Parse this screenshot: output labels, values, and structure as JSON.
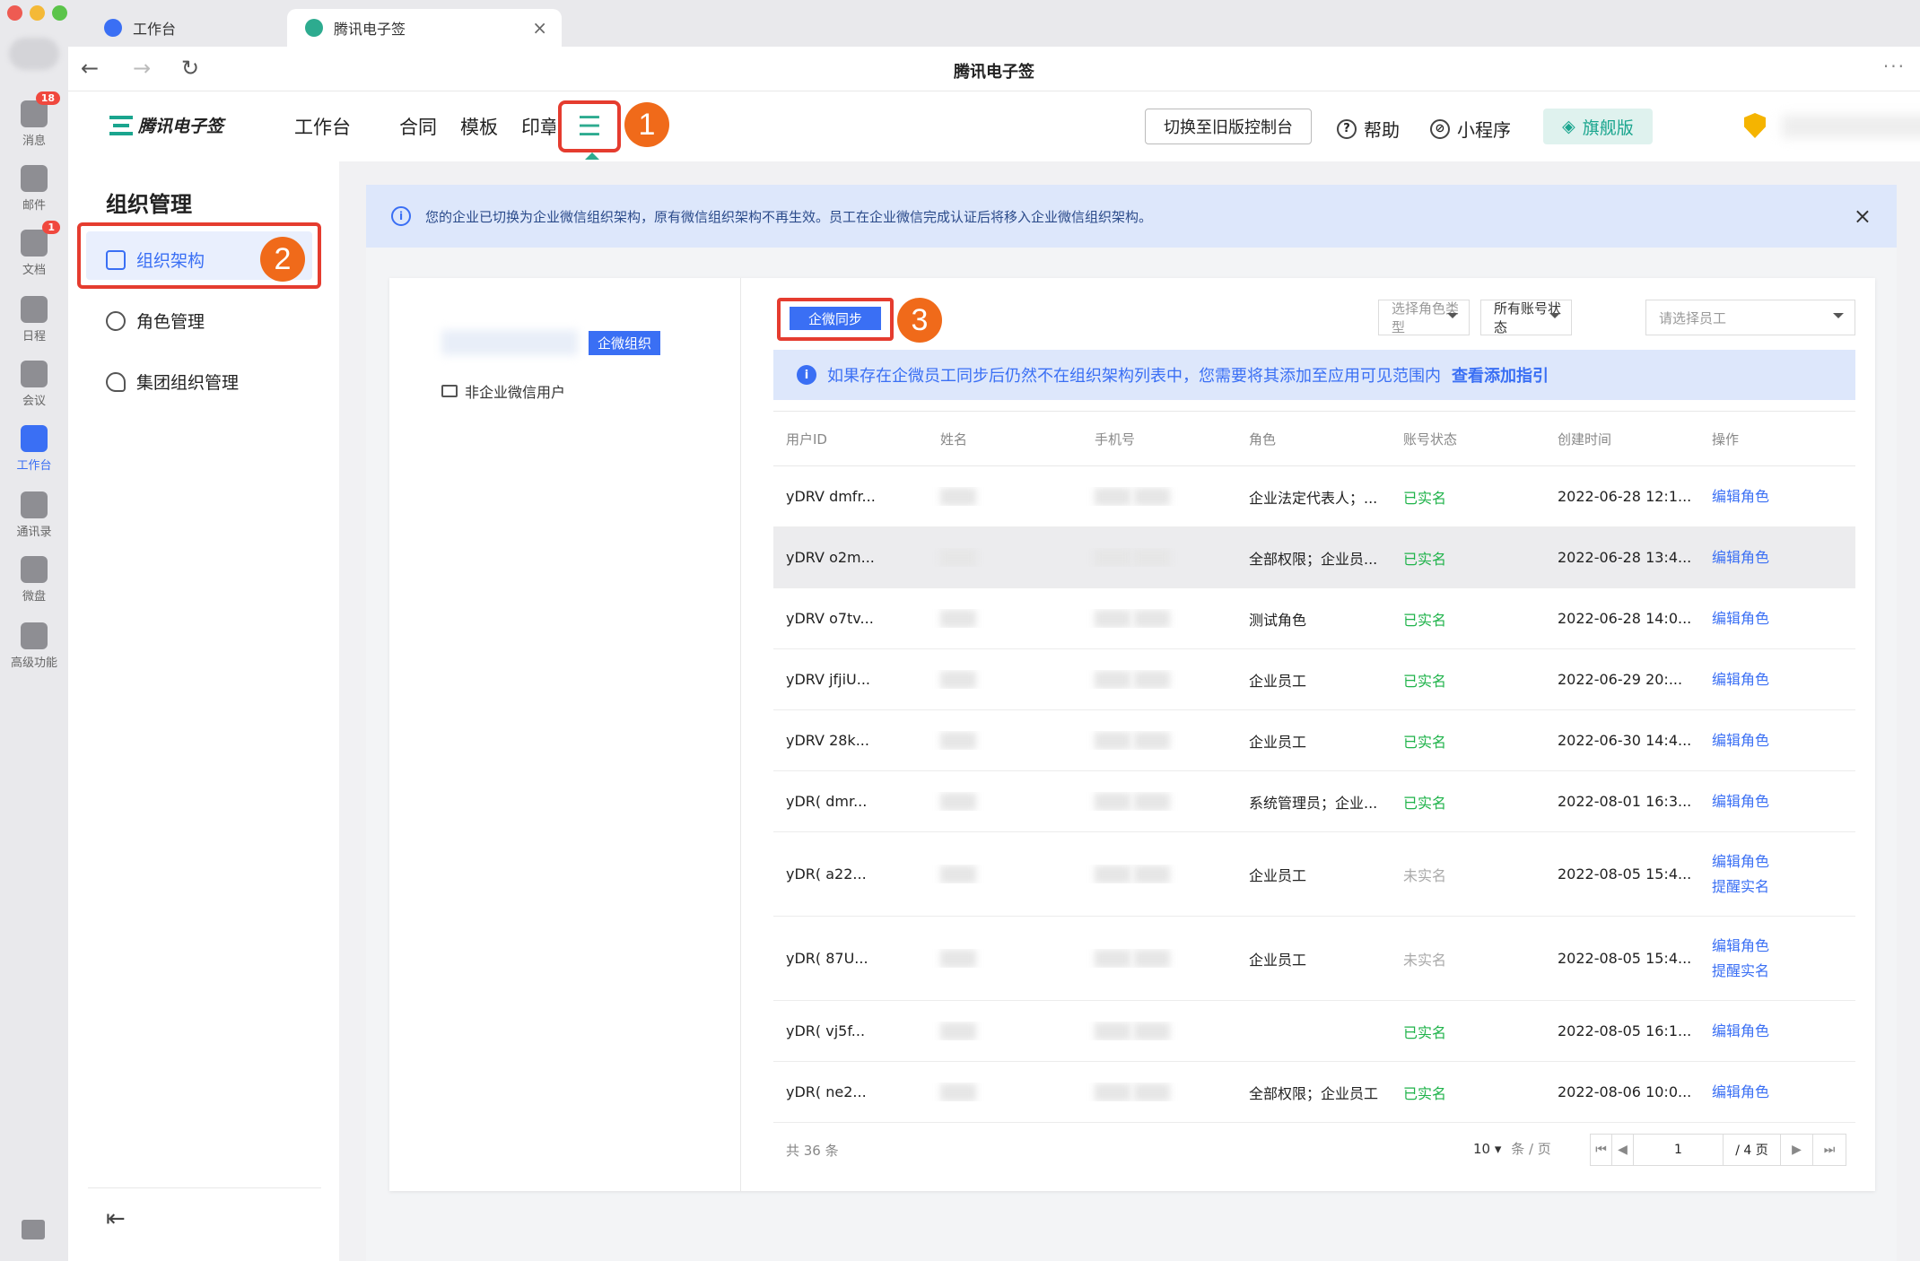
{
  "rail": {
    "items": [
      {
        "label": "消息",
        "badge": "18"
      },
      {
        "label": "邮件",
        "badge": ""
      },
      {
        "label": "文档",
        "badge": "1"
      },
      {
        "label": "日程",
        "badge": ""
      },
      {
        "label": "会议",
        "badge": ""
      },
      {
        "label": "工作台",
        "badge": ""
      },
      {
        "label": "通讯录",
        "badge": ""
      },
      {
        "label": "微盘",
        "badge": ""
      },
      {
        "label": "高级功能",
        "badge": ""
      }
    ]
  },
  "tabs": [
    {
      "label": "工作台"
    },
    {
      "label": "腾讯电子签"
    }
  ],
  "window": {
    "title": "腾讯电子签"
  },
  "header": {
    "logo_text": "腾讯电子签",
    "nav": [
      "工作台",
      "合同",
      "模板",
      "印章"
    ],
    "menu_glyph": "☰",
    "switch_btn": "切换至旧版控制台",
    "help": "帮助",
    "miniapp": "小程序",
    "edition": "旗舰版"
  },
  "callouts": [
    "1",
    "2",
    "3"
  ],
  "sidebar": {
    "title": "组织管理",
    "items": [
      {
        "label": "组织架构"
      },
      {
        "label": "角色管理"
      },
      {
        "label": "集团组织管理"
      }
    ]
  },
  "notice": {
    "text": "您的企业已切换为企业微信组织架构，原有微信组织架构不再生效。员工在企业微信完成认证后将移入企业微信组织架构。"
  },
  "tree": {
    "org_tag": "企微组织",
    "noncorp": "非企业微信用户"
  },
  "toolbar": {
    "sync_btn": "企微同步",
    "role_type": "选择角色类型",
    "account_status": "所有账号状态",
    "employee": "请选择员工"
  },
  "tip": {
    "text": "如果存在企微员工同步后仍然不在组织架构列表中，您需要将其添加至应用可见范围内",
    "link": "查看添加指引"
  },
  "table": {
    "headers": [
      "用户ID",
      "姓名",
      "手机号",
      "角色",
      "账号状态",
      "创建时间",
      "操作"
    ],
    "rows": [
      {
        "id": "yDRV  dmfr...",
        "role": "企业法定代表人；...",
        "status": "已实名",
        "status_ok": true,
        "created": "2022-06-28 12:1...",
        "actions": [
          "编辑角色"
        ]
      },
      {
        "id": "yDRV  o2m...",
        "role": "全部权限；企业员...",
        "status": "已实名",
        "status_ok": true,
        "created": "2022-06-28 13:4...",
        "actions": [
          "编辑角色"
        ]
      },
      {
        "id": "yDRV  o7tv...",
        "role": "测试角色",
        "status": "已实名",
        "status_ok": true,
        "created": "2022-06-28 14:0...",
        "actions": [
          "编辑角色"
        ]
      },
      {
        "id": "yDRV  jfjiU...",
        "role": "企业员工",
        "status": "已实名",
        "status_ok": true,
        "created": "2022-06-29 20:...",
        "actions": [
          "编辑角色"
        ]
      },
      {
        "id": "yDRV  28k...",
        "role": "企业员工",
        "status": "已实名",
        "status_ok": true,
        "created": "2022-06-30 14:4...",
        "actions": [
          "编辑角色"
        ]
      },
      {
        "id": "yDR(  dmr...",
        "role": "系统管理员；企业...",
        "status": "已实名",
        "status_ok": true,
        "created": "2022-08-01 16:3...",
        "actions": [
          "编辑角色"
        ]
      },
      {
        "id": "yDR(  a22...",
        "role": "企业员工",
        "status": "未实名",
        "status_ok": false,
        "created": "2022-08-05 15:4...",
        "actions": [
          "编辑角色",
          "提醒实名"
        ]
      },
      {
        "id": "yDR(  87U...",
        "role": "企业员工",
        "status": "未实名",
        "status_ok": false,
        "created": "2022-08-05 15:4...",
        "actions": [
          "编辑角色",
          "提醒实名"
        ]
      },
      {
        "id": "yDR(  vj5f...",
        "role": "",
        "status": "已实名",
        "status_ok": true,
        "created": "2022-08-05 16:1...",
        "actions": [
          "编辑角色"
        ]
      },
      {
        "id": "yDR(  ne2...",
        "role": "全部权限；企业员工",
        "status": "已实名",
        "status_ok": true,
        "created": "2022-08-06 10:0...",
        "actions": [
          "编辑角色"
        ]
      }
    ]
  },
  "footer": {
    "total": "共 36 条",
    "page_size": "10",
    "page_size_unit": "条 / 页",
    "page": "1",
    "page_total": "/ 4 页"
  }
}
